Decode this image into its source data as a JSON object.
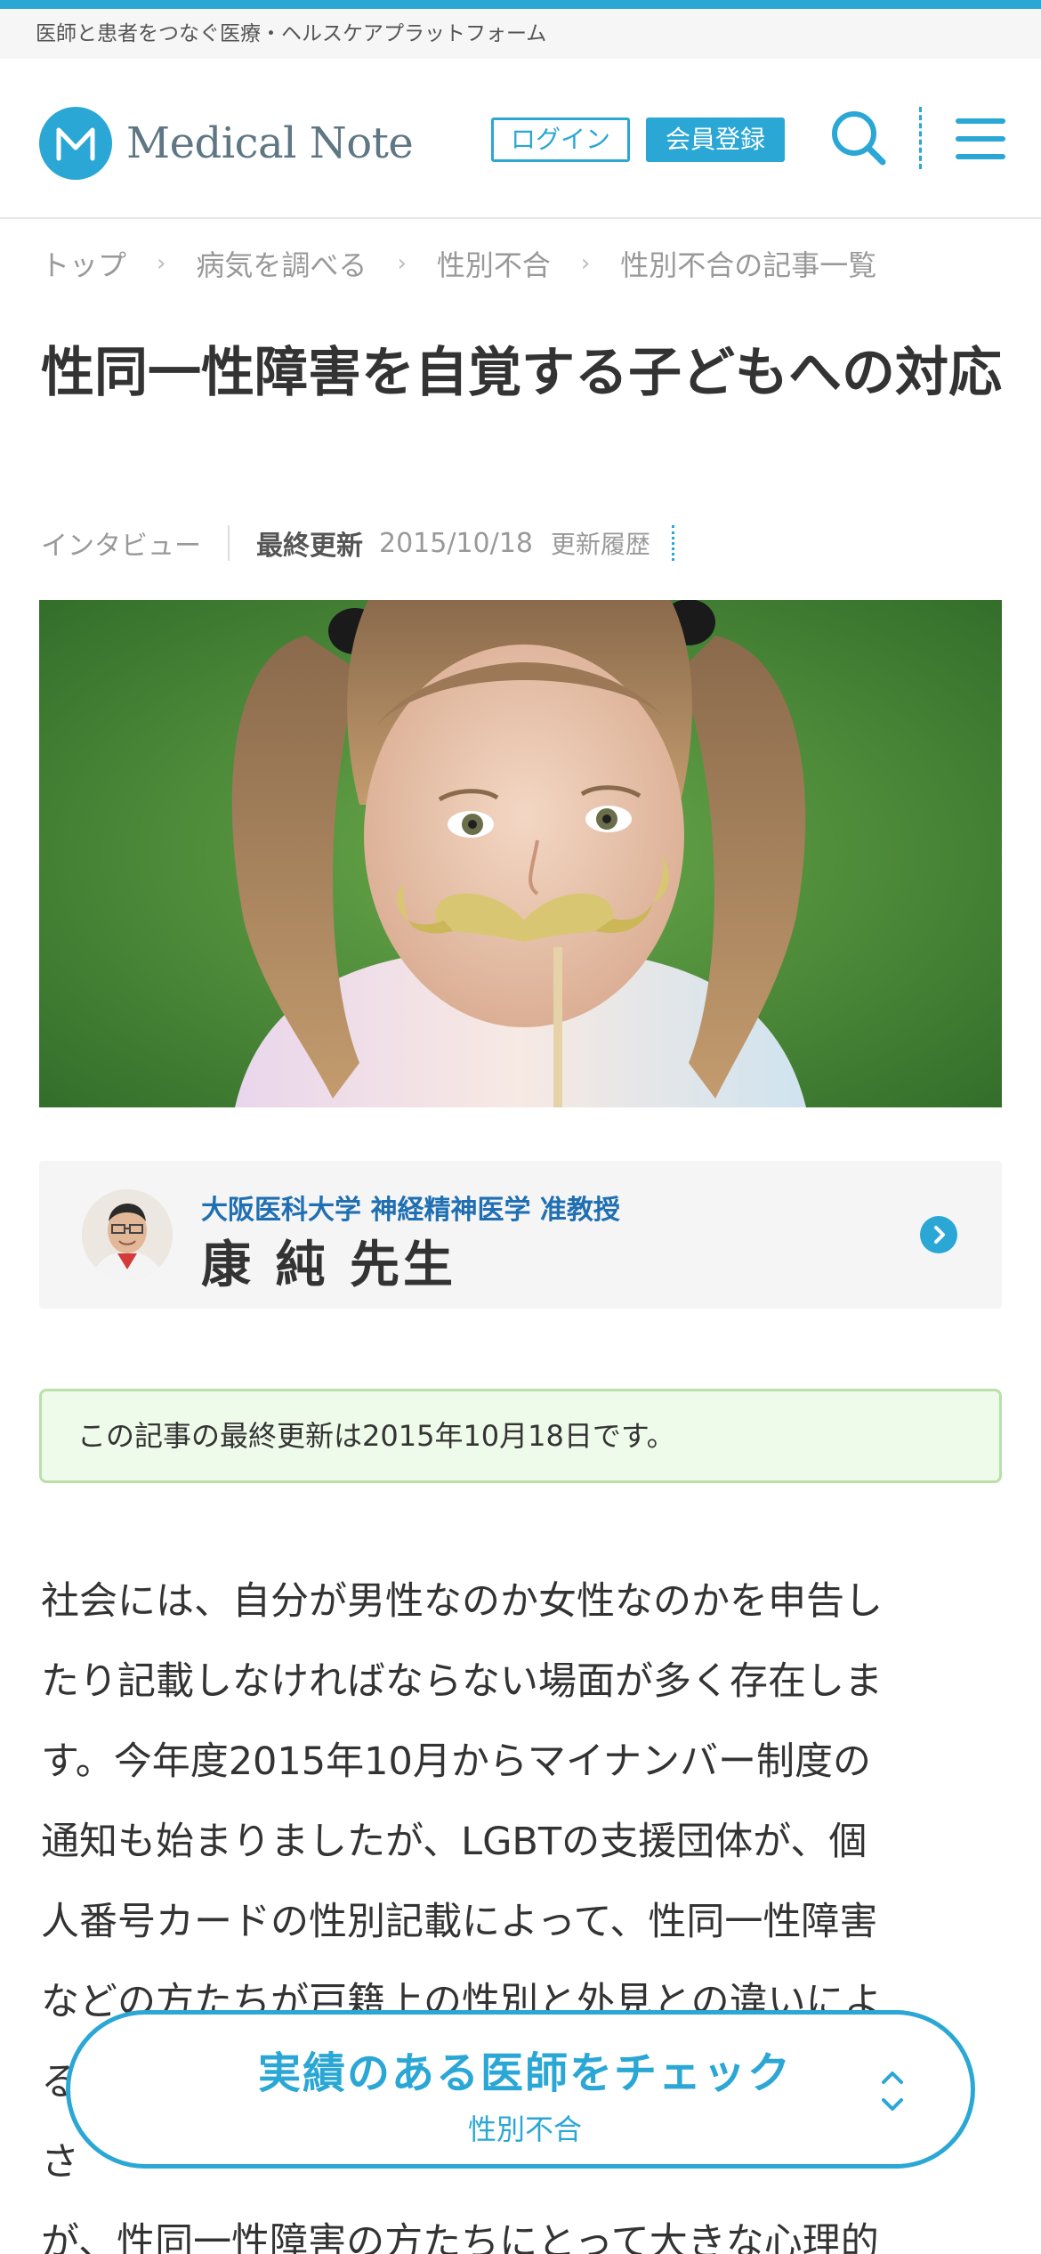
{
  "tagline": "医師と患者をつなぐ医療・ヘルスケアプラットフォーム",
  "header": {
    "logo_text": "Medical Note",
    "login_label": "ログイン",
    "register_label": "会員登録"
  },
  "breadcrumb": [
    {
      "label": "トップ"
    },
    {
      "label": "病気を調べる"
    },
    {
      "label": "性別不合"
    },
    {
      "label": "性別不合の記事一覧"
    }
  ],
  "article": {
    "title": "性同一性障害を自覚する子どもへの対応",
    "type": "インタビュー",
    "updated_label": "最終更新",
    "updated_date": "2015/10/18",
    "history_label": "更新履歴",
    "hero_image_alt": "ヒゲの小道具を持つ女の子"
  },
  "doctor": {
    "affiliation": "大阪医科大学 神経精神医学 准教授",
    "name": "康 純 先生"
  },
  "notice": "この記事の最終更新は2015年10月18日です。",
  "body_lines": [
    "社会には、自分が男性なのか女性なのかを申告し",
    "たり記載しなければならない場面が多く存在しま",
    "す。今年度2015年10月からマイナンバー制度の",
    "通知も始まりましたが、LGBTの支援団体が、個",
    "人番号カードの性別記載によって、性同一性障害",
    "などの方たちが戸籍上の性別と外見との違いによ",
    "る",
    "さ",
    "が、性同一性障害の方たちにとって大きな心理的"
  ],
  "cta": {
    "main": "実績のある医師をチェック",
    "sub": "性別不合"
  },
  "colors": {
    "brand": "#2aa7d5",
    "affiliation": "#1f6fb2",
    "notice_bg": "#effbea",
    "notice_border": "#b8e0a8"
  }
}
